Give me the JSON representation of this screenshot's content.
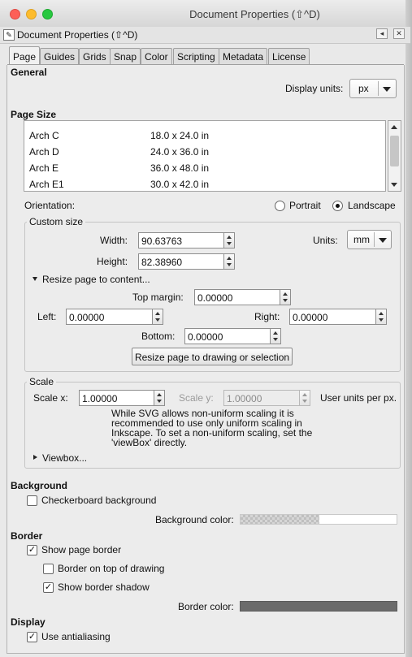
{
  "window": {
    "title": "Document Properties (⇧^D)"
  },
  "dock": {
    "title": "Document Properties (⇧^D)",
    "icon_glyph": "✎"
  },
  "tabs": [
    {
      "label": "Page",
      "active": true
    },
    {
      "label": "Guides"
    },
    {
      "label": "Grids"
    },
    {
      "label": "Snap"
    },
    {
      "label": "Color"
    },
    {
      "label": "Scripting"
    },
    {
      "label": "Metadata"
    },
    {
      "label": "License"
    }
  ],
  "general": {
    "heading": "General",
    "display_units_label": "Display units:",
    "display_units_value": "px"
  },
  "page_size": {
    "heading": "Page Size",
    "rows": [
      {
        "name": "Arch C",
        "size": "18.0 x 24.0 in"
      },
      {
        "name": "Arch D",
        "size": "24.0 x 36.0 in"
      },
      {
        "name": "Arch E",
        "size": "36.0 x 48.0 in"
      },
      {
        "name": "Arch E1",
        "size": "30.0 x 42.0 in"
      }
    ]
  },
  "orientation": {
    "label": "Orientation:",
    "portrait": "Portrait",
    "landscape": "Landscape",
    "selected": "landscape"
  },
  "custom_size": {
    "title": "Custom size",
    "width_label": "Width:",
    "width_value": "90.63763",
    "height_label": "Height:",
    "height_value": "82.38960",
    "units_label": "Units:",
    "units_value": "mm",
    "resize_expander": "Resize page to content...",
    "top_margin_label": "Top margin:",
    "top_margin_value": "0.00000",
    "left_label": "Left:",
    "left_value": "0.00000",
    "right_label": "Right:",
    "right_value": "0.00000",
    "bottom_label": "Bottom:",
    "bottom_value": "0.00000",
    "resize_button": "Resize page to drawing or selection"
  },
  "scale": {
    "title": "Scale",
    "scale_x_label": "Scale x:",
    "scale_x_value": "1.00000",
    "scale_y_label": "Scale y:",
    "scale_y_value": "1.00000",
    "units_note": "User units per px.",
    "info_line1": "While SVG allows non-uniform scaling it is",
    "info_line2": "recommended to use only uniform scaling in",
    "info_line3": "Inkscape. To set a non-uniform scaling, set the",
    "info_line4": "'viewBox' directly.",
    "viewbox_expander": "Viewbox..."
  },
  "background": {
    "heading": "Background",
    "checkerboard_label": "Checkerboard background",
    "checkerboard_checked": false,
    "color_label": "Background color:"
  },
  "border": {
    "heading": "Border",
    "show_border_label": "Show page border",
    "show_border_checked": true,
    "on_top_label": "Border on top of drawing",
    "on_top_checked": false,
    "shadow_label": "Show border shadow",
    "shadow_checked": true,
    "color_label": "Border color:",
    "color": "#6b6b6b"
  },
  "display": {
    "heading": "Display",
    "antialias_label": "Use antialiasing",
    "antialias_checked": true
  },
  "check_glyph": "✓"
}
